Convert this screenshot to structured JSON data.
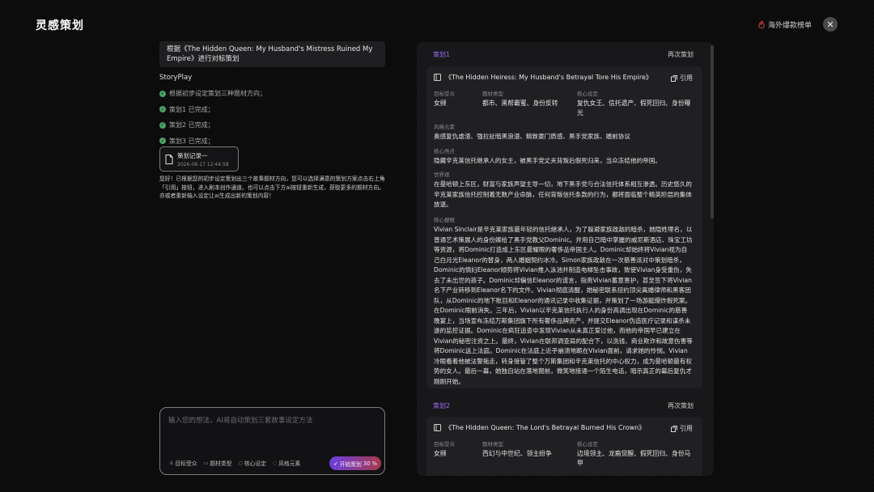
{
  "header": {
    "app_title": "灵感策划",
    "hot_link": "海外爆款榜单",
    "close_glyph": "✕"
  },
  "chat": {
    "request": "根据《The Hidden Queen: My Husband's Mistress Ruined My Empire》进行对标策划",
    "bot_name": "StoryPlay",
    "steps": [
      "根据初步设定策划三种题材方向；",
      "策划1 已完成；",
      "策划2 已完成；",
      "策划3 已完成；"
    ],
    "record": {
      "title": "策划记录一",
      "date": "2026-08-17 12:44:58"
    },
    "reply": "您好！已根据您的初步设定策划出三个故事题材方向，您可以选择满意的策划方案点击右上角「引用」按钮，进入剧本创作通道。也可以点击下方ai按钮重新生成，获取更多的题材方向。亦或者重新输入设定让ai生成出新的策划内容！"
  },
  "input": {
    "placeholder": "输入您的想法，AI将自动策划三套故事设定方法",
    "chips": [
      "目标受众",
      "题材类型",
      "核心设定",
      "风格元素"
    ],
    "start_label": "开始策划",
    "start_count": "30",
    "start_unit": "%"
  },
  "plans": [
    {
      "label": "策划1",
      "replan": "再次策划",
      "title": "《The Hidden Heiress: My Husband's Betrayal Tore His Empire》",
      "quote": "引用",
      "fields": [
        {
          "label": "目标受众",
          "value": "女频"
        },
        {
          "label": "题材类型",
          "value": "都市、黑帮霸蜜、身份反转"
        },
        {
          "label": "核心设定",
          "value": "复仇女王、信托遗产、假死回归、身份曝光"
        }
      ],
      "style_label": "风格元素",
      "style_value": "奥感复仇虐渣、强拉扯暗黑浪漫、精致豪门质感、黑手党家族、婚前协议",
      "highlight_label": "核心亮点",
      "highlight_value": "隐藏辛克莱信托继承人的女主，被黑手党丈夫背叛后假死归来，当众冻结他的帝国。",
      "world_label": "世界观",
      "world_value": "在曼哈顿上东区，财富与家族声望主导一切，地下黑手党与合法信托体系相互渗透。历史悠久的辛克莱家族信托控制着无数产业命脉，任何背叛信托条款的行为，都将面临整个精英阶层的集体放逐。",
      "outline_label": "核心梗概",
      "outline_value": "Vivian Sinclair是辛克莱家族最年轻的信托继承人，为了躲避家族政敌的暗杀，她隐姓埋名，以普通艺术策展人的身份嫁给了黑手党教父Dominic。并用自己暗中掌握的威尼斯酒店、珠宝工坊等资源，将Dominic打造成上东区最耀眼的奢侈品帝国主人。Dominic却始终将Vivian视为自己白月光Eleanor的替身，两人婚姻契约冰冷。Simon家族政敌在一次慈善派对中策划暗杀，Dominic的情妇Eleanor顺势将Vivian推入泳池并制造电梯坠击事故，致使Vivian身受重伤，失去了未出世的孩子。Dominic却偏信Eleanor的谎言，指责Vivian蓄意害护，甚至签下将Vivian名下产业转移到Eleanor名下的文件。Vivian彻底清醒，她秘密联系扭约顶尖离婚律师和黑客团队，从Dominic的地下账目和Eleanor的通讯记录中收集证据，并策划了一场游艇爆炸假死案。在Dominic眼前消失。三年后，Vivian以辛克莱信托执行人的身份高调出现在Dominic的慈善晚宴上，当场宣布冻结万斯集团旗下所有奢侈品牌资产，并提交Eleanor伪造医疗记录和谋杀未遂的监控证据。Dominic在疯狂追查中发现Vivian从未真正爱过他，而他的帝国早已建立在Vivian的秘密注资之上。最终，Vivian在联邦调查局的配合下，以洗钱、商业欺诈和故意伤害等将Dominic送上法庭。Dominic在法庭上近乎崩溃地跪在Vivian面前，请求她的怜悯。Vivian冷眼看着他被法警拖走，转身接管了整个万斯集团和辛克莱信托的中心权力，成为曼哈顿最有权势的女人。最后一幕，她独自站在落地窗前，微笑地接通一个陌生电话，暗示真正的幕后复仇才刚刚开始。"
    },
    {
      "label": "策划2",
      "replan": "再次策划",
      "title": "《The Hidden Queen: The Lord's Betrayal Burned His Crown》",
      "quote": "引用",
      "fields": [
        {
          "label": "目标受众",
          "value": "女频"
        },
        {
          "label": "题材类型",
          "value": "西幻与中世纪、领主纷争"
        },
        {
          "label": "核心设定",
          "value": "边境领主、龙裔觉醒、假死回归、身份马甲"
        }
      ]
    }
  ]
}
